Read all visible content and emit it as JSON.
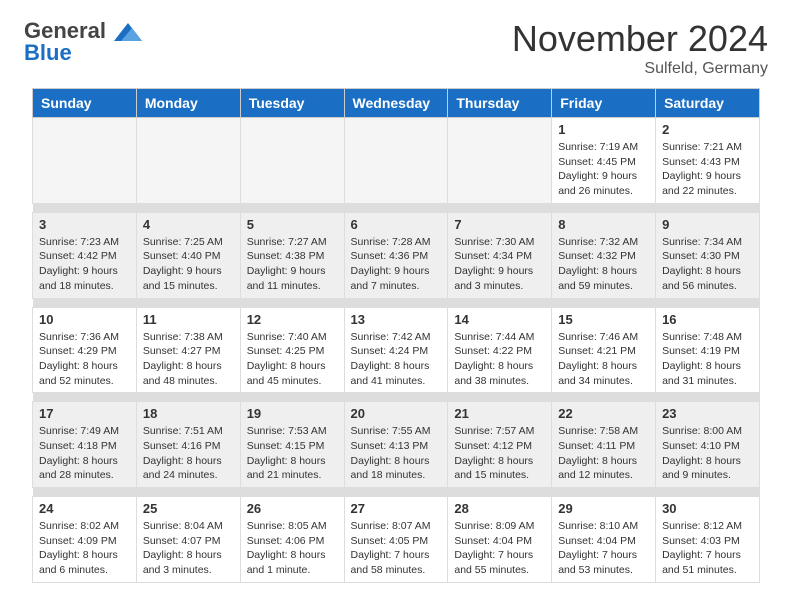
{
  "header": {
    "logo_general": "General",
    "logo_blue": "Blue",
    "month_title": "November 2024",
    "location": "Sulfeld, Germany"
  },
  "columns": [
    "Sunday",
    "Monday",
    "Tuesday",
    "Wednesday",
    "Thursday",
    "Friday",
    "Saturday"
  ],
  "weeks": [
    [
      {
        "day": "",
        "info": ""
      },
      {
        "day": "",
        "info": ""
      },
      {
        "day": "",
        "info": ""
      },
      {
        "day": "",
        "info": ""
      },
      {
        "day": "",
        "info": ""
      },
      {
        "day": "1",
        "info": "Sunrise: 7:19 AM\nSunset: 4:45 PM\nDaylight: 9 hours and 26 minutes."
      },
      {
        "day": "2",
        "info": "Sunrise: 7:21 AM\nSunset: 4:43 PM\nDaylight: 9 hours and 22 minutes."
      }
    ],
    [
      {
        "day": "3",
        "info": "Sunrise: 7:23 AM\nSunset: 4:42 PM\nDaylight: 9 hours and 18 minutes."
      },
      {
        "day": "4",
        "info": "Sunrise: 7:25 AM\nSunset: 4:40 PM\nDaylight: 9 hours and 15 minutes."
      },
      {
        "day": "5",
        "info": "Sunrise: 7:27 AM\nSunset: 4:38 PM\nDaylight: 9 hours and 11 minutes."
      },
      {
        "day": "6",
        "info": "Sunrise: 7:28 AM\nSunset: 4:36 PM\nDaylight: 9 hours and 7 minutes."
      },
      {
        "day": "7",
        "info": "Sunrise: 7:30 AM\nSunset: 4:34 PM\nDaylight: 9 hours and 3 minutes."
      },
      {
        "day": "8",
        "info": "Sunrise: 7:32 AM\nSunset: 4:32 PM\nDaylight: 8 hours and 59 minutes."
      },
      {
        "day": "9",
        "info": "Sunrise: 7:34 AM\nSunset: 4:30 PM\nDaylight: 8 hours and 56 minutes."
      }
    ],
    [
      {
        "day": "10",
        "info": "Sunrise: 7:36 AM\nSunset: 4:29 PM\nDaylight: 8 hours and 52 minutes."
      },
      {
        "day": "11",
        "info": "Sunrise: 7:38 AM\nSunset: 4:27 PM\nDaylight: 8 hours and 48 minutes."
      },
      {
        "day": "12",
        "info": "Sunrise: 7:40 AM\nSunset: 4:25 PM\nDaylight: 8 hours and 45 minutes."
      },
      {
        "day": "13",
        "info": "Sunrise: 7:42 AM\nSunset: 4:24 PM\nDaylight: 8 hours and 41 minutes."
      },
      {
        "day": "14",
        "info": "Sunrise: 7:44 AM\nSunset: 4:22 PM\nDaylight: 8 hours and 38 minutes."
      },
      {
        "day": "15",
        "info": "Sunrise: 7:46 AM\nSunset: 4:21 PM\nDaylight: 8 hours and 34 minutes."
      },
      {
        "day": "16",
        "info": "Sunrise: 7:48 AM\nSunset: 4:19 PM\nDaylight: 8 hours and 31 minutes."
      }
    ],
    [
      {
        "day": "17",
        "info": "Sunrise: 7:49 AM\nSunset: 4:18 PM\nDaylight: 8 hours and 28 minutes."
      },
      {
        "day": "18",
        "info": "Sunrise: 7:51 AM\nSunset: 4:16 PM\nDaylight: 8 hours and 24 minutes."
      },
      {
        "day": "19",
        "info": "Sunrise: 7:53 AM\nSunset: 4:15 PM\nDaylight: 8 hours and 21 minutes."
      },
      {
        "day": "20",
        "info": "Sunrise: 7:55 AM\nSunset: 4:13 PM\nDaylight: 8 hours and 18 minutes."
      },
      {
        "day": "21",
        "info": "Sunrise: 7:57 AM\nSunset: 4:12 PM\nDaylight: 8 hours and 15 minutes."
      },
      {
        "day": "22",
        "info": "Sunrise: 7:58 AM\nSunset: 4:11 PM\nDaylight: 8 hours and 12 minutes."
      },
      {
        "day": "23",
        "info": "Sunrise: 8:00 AM\nSunset: 4:10 PM\nDaylight: 8 hours and 9 minutes."
      }
    ],
    [
      {
        "day": "24",
        "info": "Sunrise: 8:02 AM\nSunset: 4:09 PM\nDaylight: 8 hours and 6 minutes."
      },
      {
        "day": "25",
        "info": "Sunrise: 8:04 AM\nSunset: 4:07 PM\nDaylight: 8 hours and 3 minutes."
      },
      {
        "day": "26",
        "info": "Sunrise: 8:05 AM\nSunset: 4:06 PM\nDaylight: 8 hours and 1 minute."
      },
      {
        "day": "27",
        "info": "Sunrise: 8:07 AM\nSunset: 4:05 PM\nDaylight: 7 hours and 58 minutes."
      },
      {
        "day": "28",
        "info": "Sunrise: 8:09 AM\nSunset: 4:04 PM\nDaylight: 7 hours and 55 minutes."
      },
      {
        "day": "29",
        "info": "Sunrise: 8:10 AM\nSunset: 4:04 PM\nDaylight: 7 hours and 53 minutes."
      },
      {
        "day": "30",
        "info": "Sunrise: 8:12 AM\nSunset: 4:03 PM\nDaylight: 7 hours and 51 minutes."
      }
    ]
  ]
}
